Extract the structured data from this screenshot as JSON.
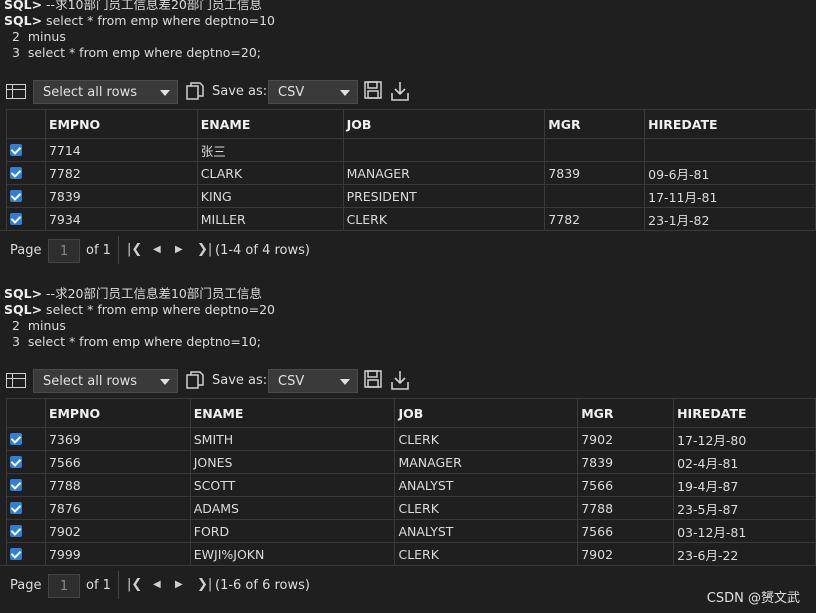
{
  "blocks": [
    {
      "sql_lines": [
        {
          "prompt": "SQL>",
          "text": " --求10部门员工信息差20部门员工信息"
        },
        {
          "prompt": "SQL>",
          "text": " select * from emp where deptno=10"
        },
        {
          "prompt": "",
          "text": "  2  minus"
        },
        {
          "prompt": "",
          "text": "  3  select * from emp where deptno=20;"
        }
      ],
      "toolbar": {
        "select_label": "Select all rows",
        "save_as_label": "Save as:",
        "format_value": "CSV"
      },
      "columns": [
        "EMPNO",
        "ENAME",
        "JOB",
        "MGR",
        "HIREDATE"
      ],
      "rows": [
        [
          "7714",
          "张三",
          "",
          "",
          ""
        ],
        [
          "7782",
          "CLARK",
          "MANAGER",
          "7839",
          "09-6月-81"
        ],
        [
          "7839",
          "KING",
          "PRESIDENT",
          "",
          "17-11月-81"
        ],
        [
          "7934",
          "MILLER",
          "CLERK",
          "7782",
          "23-1月-82"
        ]
      ],
      "pager": {
        "page_label": "Page",
        "page_value": "1",
        "of_label": "of 1",
        "rows_info": "(1-4 of 4 rows)"
      }
    },
    {
      "sql_lines": [
        {
          "prompt": "SQL>",
          "text": " --求20部门员工信息差10部门员工信息"
        },
        {
          "prompt": "SQL>",
          "text": " select * from emp where deptno=20"
        },
        {
          "prompt": "",
          "text": "  2  minus"
        },
        {
          "prompt": "",
          "text": "  3  select * from emp where deptno=10;"
        }
      ],
      "toolbar": {
        "select_label": "Select all rows",
        "save_as_label": "Save as:",
        "format_value": "CSV"
      },
      "columns": [
        "EMPNO",
        "ENAME",
        "JOB",
        "MGR",
        "HIREDATE"
      ],
      "rows": [
        [
          "7369",
          "SMITH",
          "CLERK",
          "7902",
          "17-12月-80"
        ],
        [
          "7566",
          "JONES",
          "MANAGER",
          "7839",
          "02-4月-81"
        ],
        [
          "7788",
          "SCOTT",
          "ANALYST",
          "7566",
          "19-4月-87"
        ],
        [
          "7876",
          "ADAMS",
          "CLERK",
          "7788",
          "23-5月-87"
        ],
        [
          "7902",
          "FORD",
          "ANALYST",
          "7566",
          "03-12月-81"
        ],
        [
          "7999",
          "EWJI%JOKN",
          "CLERK",
          "7902",
          "23-6月-22"
        ]
      ],
      "pager": {
        "page_label": "Page",
        "page_value": "1",
        "of_label": "of 1",
        "rows_info": "(1-6 of 6 rows)"
      }
    }
  ],
  "watermark": "CSDN @赟文武",
  "accent_color": "#2f7fd9"
}
